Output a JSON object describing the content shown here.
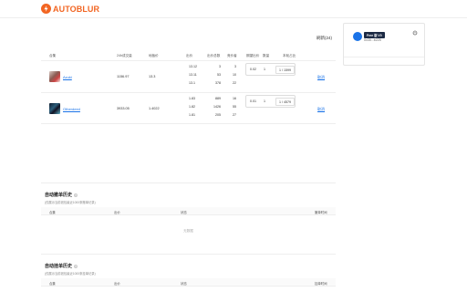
{
  "brand": {
    "name": "AUTOBLUR"
  },
  "toolbar": {
    "refresh_label": "刷新(24)"
  },
  "table": {
    "headers": [
      "合集",
      "24h成交量",
      "地板价",
      "出价",
      "出价总数",
      "竞价者",
      "期望出价",
      "数量",
      "本轮占比"
    ],
    "rows": [
      {
        "name": "Azuki",
        "volume": "1156.97",
        "floor": "13.3",
        "bids": [
          "13.12",
          "13.11",
          "13.1"
        ],
        "bid_totals": [
          "3",
          "53",
          "378"
        ],
        "bidders": [
          "3",
          "10",
          "22"
        ],
        "expected_bid": "0.02",
        "quantity": "1",
        "ratio": "1 / 1599",
        "action": "取消"
      },
      {
        "name": "Otherdeed",
        "volume": "3933.05",
        "floor": "1.4022",
        "bids": [
          "1.83",
          "1.82",
          "1.81"
        ],
        "bid_totals": [
          "889",
          "1426",
          "205"
        ],
        "bidders": [
          "16",
          "55",
          "27"
        ],
        "expected_bid": "0.01",
        "quantity": "1",
        "ratio": "1 / 4579",
        "action": "取消"
      }
    ]
  },
  "auto_cancel": {
    "title": "自动撤单历史",
    "subtitle": "(仅展示当前钱包最近1000条撤单记录)",
    "headers": [
      "合集",
      "出价",
      "状态",
      "撤单时间"
    ],
    "empty_text": "无数据"
  },
  "auto_sell": {
    "title": "自动挂单历史",
    "subtitle": "(仅展示当前钱包最近1000条挂单记录)",
    "headers": [
      "合集",
      "出价",
      "状态",
      "挂单时间"
    ]
  },
  "wallet": {
    "badge": "Free 版 V0",
    "address": "0x35...b225"
  },
  "colors": {
    "brand": "#f26522",
    "link": "#1a73e8",
    "wallet": "#1a73e8"
  }
}
